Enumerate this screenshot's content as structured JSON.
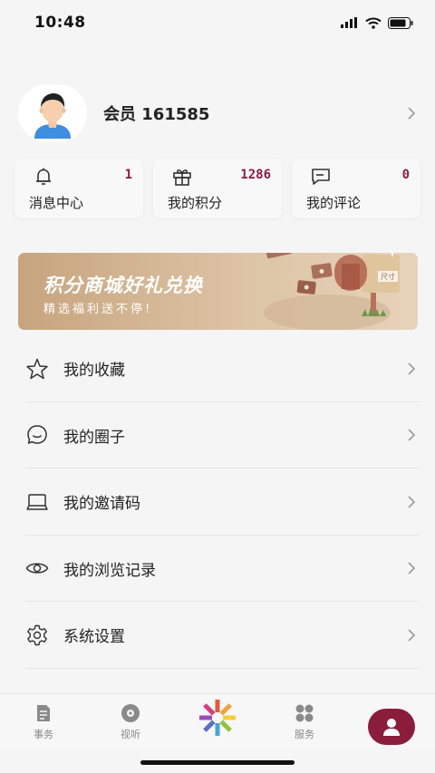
{
  "status_bar": {
    "time": "10:48"
  },
  "profile": {
    "username": "会员 161585"
  },
  "stats": [
    {
      "icon": "bell-icon",
      "count": "1",
      "label": "消息中心"
    },
    {
      "icon": "gift-icon",
      "count": "1286",
      "label": "我的积分"
    },
    {
      "icon": "comment-icon",
      "count": "0",
      "label": "我的评论"
    }
  ],
  "banner": {
    "title": "积分商城好礼兑换",
    "subtitle": "精选福利送不停!",
    "mailbox_text": "尺寸"
  },
  "menu": [
    {
      "icon": "star-icon",
      "label": "我的收藏"
    },
    {
      "icon": "chat-circle-icon",
      "label": "我的圈子"
    },
    {
      "icon": "laptop-icon",
      "label": "我的邀请码"
    },
    {
      "icon": "eye-icon",
      "label": "我的浏览记录"
    },
    {
      "icon": "gear-icon",
      "label": "系统设置"
    }
  ],
  "tabbar": [
    {
      "icon": "document-icon",
      "label": "事务"
    },
    {
      "icon": "disc-icon",
      "label": "视听"
    },
    {
      "icon": "logo-icon",
      "label": ""
    },
    {
      "icon": "grid-icon",
      "label": "服务"
    },
    {
      "icon": "user-icon",
      "label": ""
    }
  ],
  "colors": {
    "accent": "#8b1d3c",
    "banner": "#d4b593",
    "background": "#f5f5f5"
  }
}
